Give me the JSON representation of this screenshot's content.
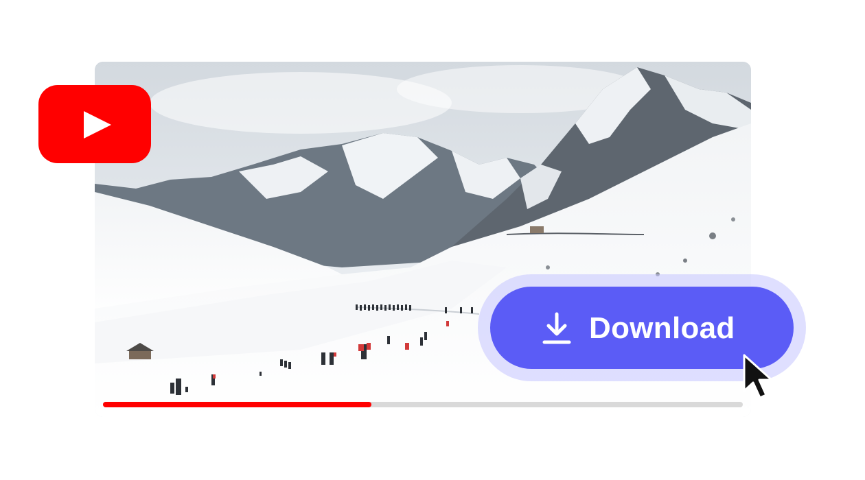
{
  "player": {
    "logo_icon": "youtube-play-icon",
    "scene": "snowy-mountain-valley-with-hikers",
    "progress_fraction": 0.42,
    "progress_color": "#ff0000",
    "track_color": "#d9d9d9"
  },
  "download": {
    "label": "Download",
    "icon": "download-arrow-icon",
    "color": "#5b5cf6",
    "halo_color": "#c4c4ff"
  },
  "cursor": {
    "icon": "mouse-pointer-icon"
  },
  "brand": {
    "logo_color": "#ff0000"
  }
}
